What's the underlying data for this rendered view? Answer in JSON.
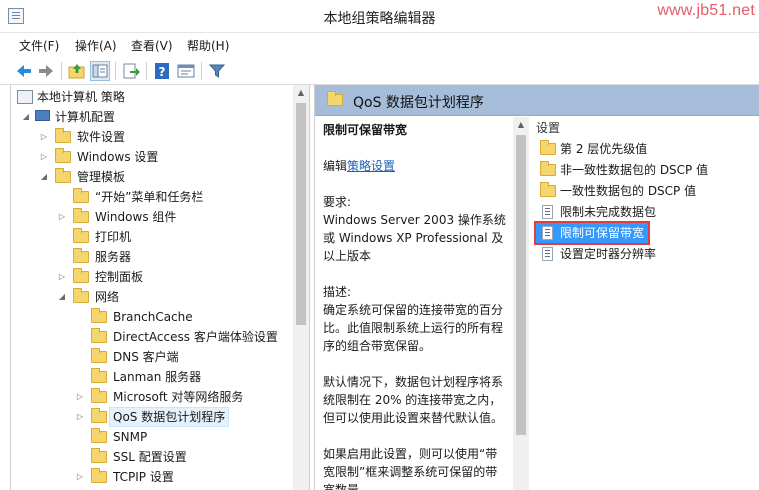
{
  "window": {
    "title": "本地组策略编辑器",
    "watermark": "www.jb51.net"
  },
  "menu": [
    "文件(F)",
    "操作(A)",
    "查看(V)",
    "帮助(H)"
  ],
  "toolbar_icons": [
    "back-arrow-icon",
    "forward-arrow-icon",
    "up-folder-icon",
    "show-hide-tree-icon",
    "export-list-icon",
    "help-icon",
    "properties-icon",
    "filter-icon"
  ],
  "tree": {
    "root": "本地计算机 策略",
    "computer_config": "计算机配置",
    "items": [
      {
        "label": "软件设置"
      },
      {
        "label": "Windows 设置"
      },
      {
        "label": "管理模板"
      },
      {
        "label": "“开始”菜单和任务栏"
      },
      {
        "label": "Windows 组件"
      },
      {
        "label": "打印机"
      },
      {
        "label": "服务器"
      },
      {
        "label": "控制面板"
      },
      {
        "label": "网络"
      },
      {
        "label": "BranchCache"
      },
      {
        "label": "DirectAccess 客户端体验设置"
      },
      {
        "label": "DNS 客户端"
      },
      {
        "label": "Lanman 服务器"
      },
      {
        "label": "Microsoft 对等网络服务"
      },
      {
        "label": "QoS 数据包计划程序"
      },
      {
        "label": "SNMP"
      },
      {
        "label": "SSL 配置设置"
      },
      {
        "label": "TCPIP 设置"
      }
    ]
  },
  "right_header": {
    "title": "QoS 数据包计划程序"
  },
  "description": {
    "title": "限制可保留带宽",
    "edit_prefix": "编辑",
    "edit_link": "策略设置",
    "requirements_label": "要求:",
    "requirements": "Windows Server 2003 操作系统或 Windows XP Professional 及以上版本",
    "desc_label": "描述:",
    "desc": "确定系统可保留的连接带宽的百分比。此值限制系统上运行的所有程序的组合带宽保留。",
    "default": "默认情况下，数据包计划程序将系统限制在 20% 的连接带宽之内，但可以使用此设置来替代默认值。",
    "enabled": "如果启用此设置，则可以使用“带宽限制”框来调整系统可保留的带宽数量。"
  },
  "list": {
    "column": "设置",
    "items": [
      {
        "label": "第 2 层优先级值",
        "type": "folder"
      },
      {
        "label": "非一致性数据包的 DSCP 值",
        "type": "folder"
      },
      {
        "label": "一致性数据包的 DSCP 值",
        "type": "folder"
      },
      {
        "label": "限制未完成数据包",
        "type": "setting"
      },
      {
        "label": "限制可保留带宽",
        "type": "setting"
      },
      {
        "label": "设置定时器分辨率",
        "type": "setting"
      }
    ]
  },
  "colors": {
    "header_blue": "#a6bdd9",
    "selection": "#3399ff",
    "highlight_box": "#e23c3c",
    "folder": "#f5d66e"
  }
}
